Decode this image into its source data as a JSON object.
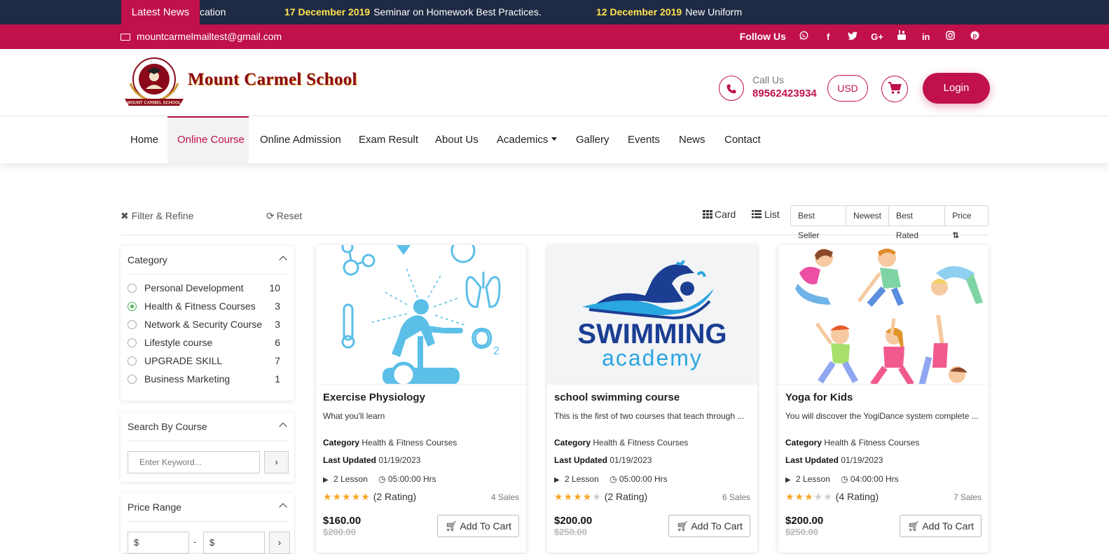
{
  "news": {
    "label": "Latest News",
    "items": [
      {
        "date": "",
        "text": "cation"
      },
      {
        "date": "17 December 2019",
        "text": "Seminar on Homework Best Practices."
      },
      {
        "date": "12 December 2019",
        "text": "New Uniform"
      }
    ]
  },
  "topbar": {
    "email": "mountcarmelmailtest@gmail.com",
    "follow_label": "Follow Us",
    "social_icons": [
      "whatsapp-icon",
      "facebook-icon",
      "twitter-icon",
      "google-plus-icon",
      "youtube-icon",
      "linkedin-icon",
      "instagram-icon",
      "pinterest-icon"
    ]
  },
  "header": {
    "school_name": "Mount Carmel School",
    "call_label": "Call Us",
    "phone": "89562423934",
    "currency": "USD",
    "login_label": "Login",
    "badge_text": "MOUNT CARMEL SCHOOL"
  },
  "nav": {
    "items": [
      "Home",
      "Online Course",
      "Online Admission",
      "Exam Result",
      "About Us",
      "Academics",
      "Gallery",
      "Events",
      "News",
      "Contact"
    ],
    "active": "Online Course"
  },
  "filters": {
    "title": "Filter & Refine",
    "reset": "Reset",
    "view_card": "Card",
    "view_list": "List",
    "sort_options": [
      "Best Seller",
      "Newest",
      "Best Rated",
      "Price"
    ]
  },
  "sidebar": {
    "category_title": "Category",
    "categories": [
      {
        "name": "Personal Development",
        "count": "10",
        "selected": false
      },
      {
        "name": "Health & Fitness Courses",
        "count": "3",
        "selected": true
      },
      {
        "name": "Network & Security Course",
        "count": "3",
        "selected": false
      },
      {
        "name": "Lifestyle course",
        "count": "6",
        "selected": false
      },
      {
        "name": "UPGRADE SKILL",
        "count": "7",
        "selected": false
      },
      {
        "name": "Business Marketing",
        "count": "1",
        "selected": false
      }
    ],
    "search_title": "Search By Course",
    "search_placeholder": "Enter Keyword...",
    "price_title": "Price Range",
    "price_min": "$",
    "price_sep": "-",
    "price_max": "$"
  },
  "courses": [
    {
      "title": "Exercise Physiology",
      "desc": "What you'll learn",
      "category_label": "Category",
      "category": "Health & Fitness Courses",
      "updated_label": "Last Updated",
      "updated": "01/19/2023",
      "lessons": "2 Lesson",
      "hours": "05:00:00 Hrs",
      "rating_count": "(2 Rating)",
      "stars": 5,
      "sales": "4 Sales",
      "price": "$160.00",
      "old_price": "$200.00",
      "cart_label": "Add To Cart"
    },
    {
      "title": "school swimming course",
      "desc": "This is the first of two courses that teach through ...",
      "category_label": "Category",
      "category": "Health & Fitness Courses",
      "updated_label": "Last Updated",
      "updated": "01/19/2023",
      "lessons": "2 Lesson",
      "hours": "05:00:00 Hrs",
      "rating_count": "(2 Rating)",
      "stars": 4,
      "sales": "6 Sales",
      "price": "$200.00",
      "old_price": "$250.00",
      "cart_label": "Add To Cart",
      "img_line1": "SWIMMING",
      "img_line2": "academy"
    },
    {
      "title": "Yoga for Kids",
      "desc": "You will discover the YogiDance system complete ...",
      "category_label": "Category",
      "category": "Health & Fitness Courses",
      "updated_label": "Last Updated",
      "updated": "01/19/2023",
      "lessons": "2 Lesson",
      "hours": "04:00:00 Hrs",
      "rating_count": "(4 Rating)",
      "stars": 3,
      "sales": "7 Sales",
      "price": "$200.00",
      "old_price": "$250.00",
      "cart_label": "Add To Cart"
    }
  ],
  "colors": {
    "brand": "#c0114a",
    "news_bg": "#1f2a44",
    "news_date": "#ffe14d",
    "star": "#f7a722"
  }
}
